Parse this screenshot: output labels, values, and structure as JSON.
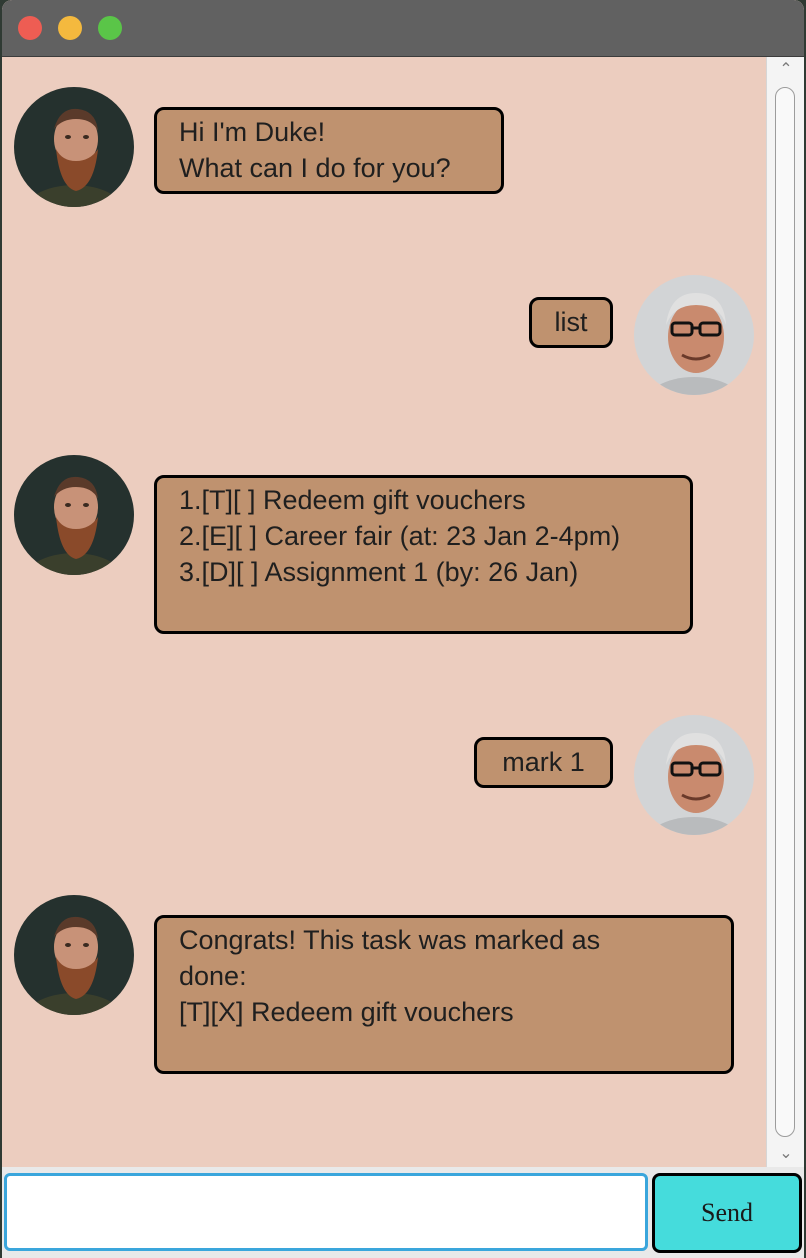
{
  "window": {
    "traffic_lights": [
      "close",
      "minimize",
      "zoom"
    ]
  },
  "messages": [
    {
      "sender": "duke",
      "lines": [
        "Hi I'm Duke!",
        "What can I do for you?"
      ]
    },
    {
      "sender": "user",
      "lines": [
        "list"
      ]
    },
    {
      "sender": "duke",
      "lines": [
        "",
        "1.[T][ ] Redeem gift vouchers",
        "2.[E][ ] Career fair (at: 23 Jan 2-4pm)",
        "3.[D][ ] Assignment 1 (by: 26 Jan)"
      ]
    },
    {
      "sender": "user",
      "lines": [
        "mark 1"
      ]
    },
    {
      "sender": "duke",
      "lines": [
        "",
        "Congrats! This task was marked as",
        "done:",
        "[T][X] Redeem gift vouchers"
      ]
    }
  ],
  "input": {
    "value": "",
    "placeholder": ""
  },
  "send_label": "Send",
  "colors": {
    "chat_background": "#eccdbf",
    "bubble": "#bf926f",
    "send_button": "#45dcdc",
    "input_focus_border": "#3aa6dc",
    "titlebar": "#616161"
  }
}
